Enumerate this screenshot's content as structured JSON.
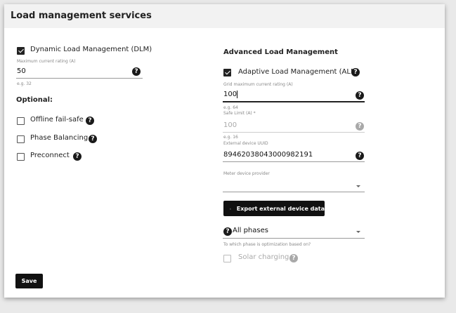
{
  "card": {
    "title": "Load management services"
  },
  "dlm": {
    "checkbox_label": "Dynamic Load Management (DLM)",
    "checked": true,
    "max_current": {
      "label": "Maximum current rating (A)",
      "value": "50",
      "hint": "e.g. 32"
    }
  },
  "optional": {
    "heading": "Optional:",
    "items": [
      {
        "label": "Offline fail-safe",
        "checked": false
      },
      {
        "label": "Phase Balancing",
        "checked": false
      },
      {
        "label": "Preconnect",
        "checked": false
      }
    ]
  },
  "alm": {
    "heading": "Advanced Load Management",
    "checkbox_label": "Adaptive Load Management (ALM)",
    "checked": true,
    "grid_max": {
      "label": "Grid maximum current rating (A)",
      "value": "100",
      "hint": "e.g. 64"
    },
    "safe_limit": {
      "label": "Safe Limit (A) *",
      "value": "100",
      "hint": "e.g. 16"
    },
    "external_uuid": {
      "label": "External device UUID",
      "value": "89462038043000982191"
    },
    "meter_provider": {
      "label": "Meter device provider",
      "value": ""
    },
    "export_button": "Export external device data",
    "phase_select": {
      "value": "All phases",
      "hint": "To which phase is optimization based on?"
    },
    "solar_charging": {
      "label": "Solar charging",
      "checked": false
    }
  },
  "save_button": "Save",
  "help_glyph": "?",
  "icons": {
    "help": "question-circle-icon",
    "download": "download-icon",
    "dropdown": "caret-down-icon"
  },
  "colors": {
    "primary": "#111111",
    "header_bg": "#f2f2f2",
    "page_bg": "#e9e9e9",
    "disabled": "#aaaaaa"
  }
}
